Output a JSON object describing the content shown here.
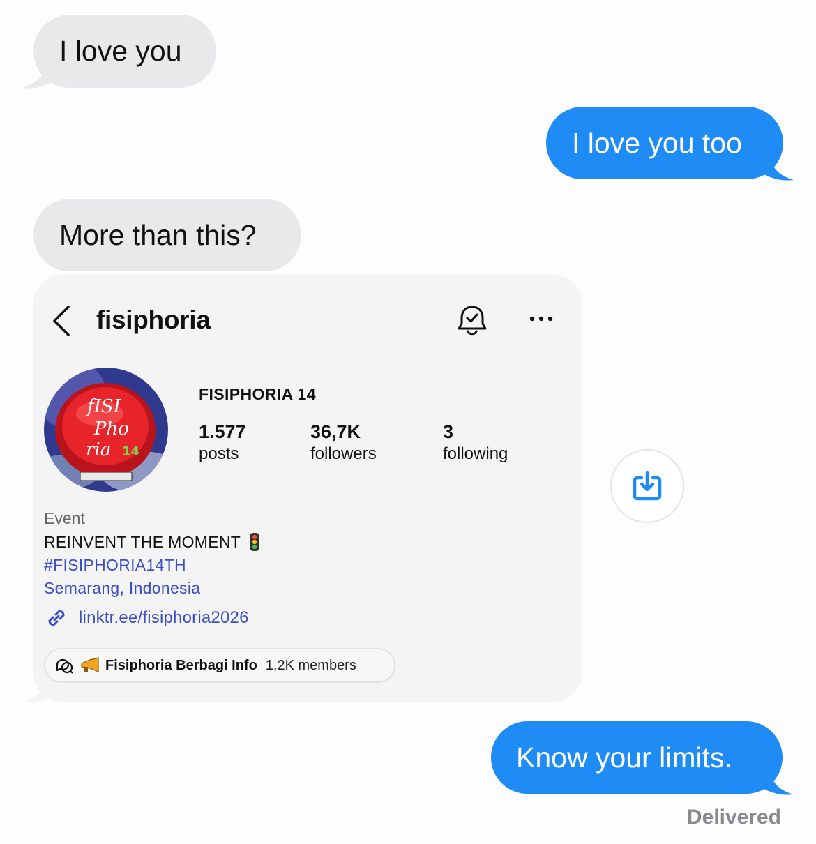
{
  "messages": [
    {
      "side": "received",
      "text": "I love you"
    },
    {
      "side": "sent",
      "text": "I love you too"
    },
    {
      "side": "received",
      "text": "More than this?"
    },
    {
      "side": "sent",
      "text": "Know your limits."
    }
  ],
  "shared_profile": {
    "username": "fisiphoria",
    "display_name": "FISIPHORIA 14",
    "stats": {
      "posts": {
        "value": "1.577",
        "label": "posts"
      },
      "followers": {
        "value": "36,7K",
        "label": "followers"
      },
      "following": {
        "value": "3",
        "label": "following"
      }
    },
    "category": "Event",
    "bio": "REINVENT THE MOMENT",
    "bio_emoji": "traffic-light",
    "hashtag": "#FISIPHORIA14TH",
    "location": "Semarang, Indonesia",
    "link": "linktr.ee/fisiphoria2026",
    "channel": {
      "name": "Fisiphoria Berbagi Info",
      "members": "1,2K members"
    },
    "icons": [
      "back-arrow-icon",
      "bell-check-icon",
      "more-icon",
      "link-icon",
      "chat-bubbles-icon",
      "megaphone-icon"
    ]
  },
  "save_button_icon": "download-icon",
  "status": "Delivered",
  "colors": {
    "sent_bubble": "#1f8bf5",
    "received_bubble": "#e9e9eb",
    "link_blue": "#3b4fc6",
    "status_gray": "#8a8a8e"
  }
}
